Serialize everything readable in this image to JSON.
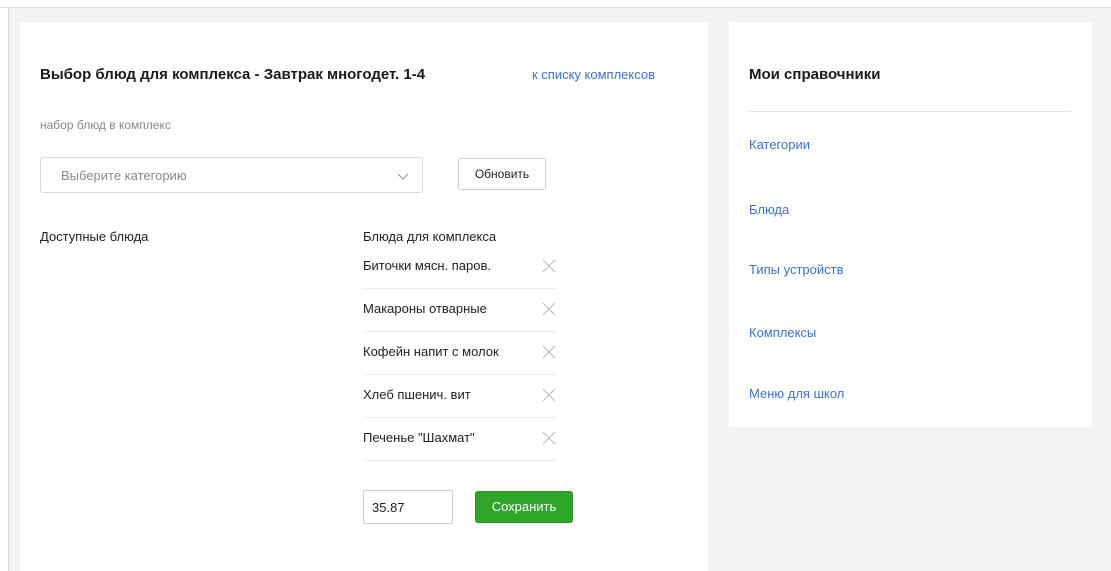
{
  "main": {
    "title": "Выбор блюд для комплекса - Завтрак многодет. 1-4",
    "back_link": "к списку комплексов",
    "subtitle": "набор блюд в комплекс",
    "category_select": {
      "placeholder": "Выберите категорию"
    },
    "update_button": "Обновить",
    "available_label": "Доступные блюда",
    "complex_label": "Блюда для комплекса",
    "dishes": [
      {
        "name": "Биточки мясн. паров."
      },
      {
        "name": "Макароны отварные"
      },
      {
        "name": "Кофейн напит с молок"
      },
      {
        "name": "Хлеб пшенич. вит"
      },
      {
        "name": "Печенье \"Шахмат\""
      }
    ],
    "price_value": "35.87",
    "save_button": "Сохранить"
  },
  "sidebar": {
    "title": "Мои справочники",
    "links": [
      {
        "label": "Категории"
      },
      {
        "label": "Блюда"
      },
      {
        "label": "Типы устройств"
      },
      {
        "label": "Комплексы"
      },
      {
        "label": "Меню для школ"
      }
    ]
  },
  "colors": {
    "link": "#3a73c9",
    "save": "#2fa52a",
    "background": "#f4f3f1"
  },
  "icons": {
    "select_chevron": "chevron-down-icon",
    "remove": "close-icon"
  }
}
